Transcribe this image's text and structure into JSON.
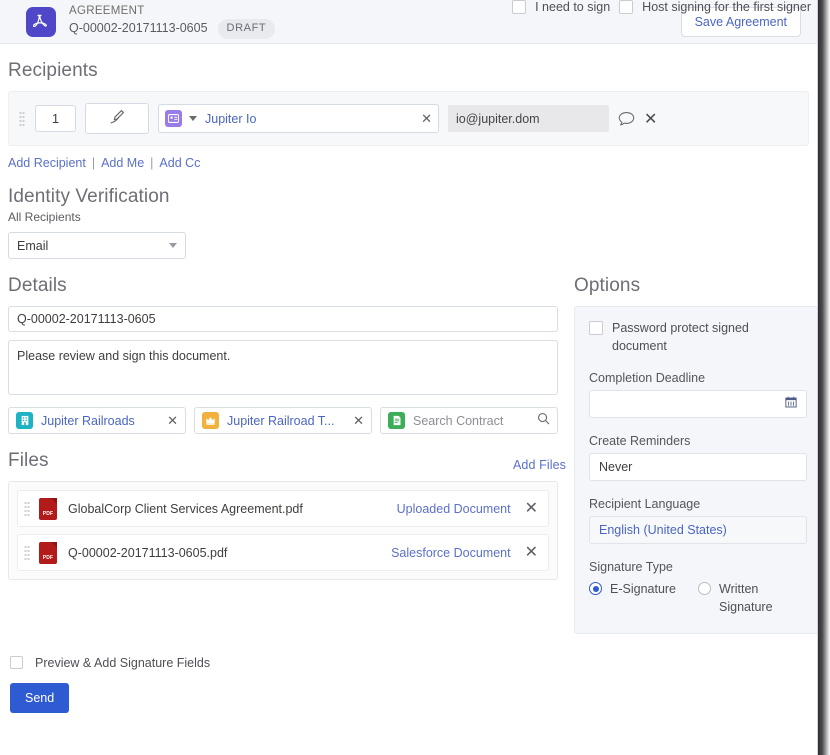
{
  "header": {
    "kicker": "AGREEMENT",
    "record_id": "Q-00002-20171113-0605",
    "status_badge": "DRAFT",
    "save_button": "Save Agreement"
  },
  "recipients": {
    "title": "Recipients",
    "row": {
      "order": "1",
      "sign_role_icon": "pen-icon",
      "object_type_icon": "contact-icon",
      "name": "Jupiter Io",
      "email": "io@jupiter.dom",
      "message_icon": "speech-bubble-icon",
      "remove_icon": "close-icon"
    },
    "links": {
      "add_recipient": "Add Recipient",
      "separator": "|",
      "add_me": "Add Me",
      "add_cc": "Add Cc"
    },
    "checkboxes": {
      "i_need_to_sign": "I need to sign",
      "host_signing": "Host signing for the first signer"
    }
  },
  "identity": {
    "title": "Identity Verification",
    "subtitle": "All Recipients",
    "method": "Email"
  },
  "details": {
    "title": "Details",
    "name_value": "Q-00002-20171113-0605",
    "message_value": "Please review and sign this document.",
    "pills": [
      {
        "icon": "account-icon",
        "color": "#1db2c4",
        "value": "Jupiter Railroads",
        "placeholder": ""
      },
      {
        "icon": "opportunity-icon",
        "color": "#f2b13c",
        "value": "Jupiter Railroad T...",
        "placeholder": ""
      },
      {
        "icon": "contract-icon",
        "color": "#3dad5a",
        "value": "",
        "placeholder": "Search Contract"
      }
    ]
  },
  "files": {
    "title": "Files",
    "add_files_link": "Add Files",
    "items": [
      {
        "name": "GlobalCorp Client Services Agreement.pdf",
        "tag": "Uploaded Document",
        "type_label": "PDF"
      },
      {
        "name": "Q-00002-20171113-0605.pdf",
        "tag": "Salesforce Document",
        "type_label": "PDF"
      }
    ]
  },
  "options": {
    "title": "Options",
    "password_protect": "Password protect signed document",
    "completion_deadline_label": "Completion Deadline",
    "completion_deadline_value": "",
    "create_reminders_label": "Create Reminders",
    "create_reminders_value": "Never",
    "recipient_language_label": "Recipient Language",
    "recipient_language_value": "English (United States)",
    "signature_type_label": "Signature Type",
    "signature_e": "E-Signature",
    "signature_written": "Written Signature"
  },
  "footer": {
    "preview_checkbox": "Preview & Add Signature Fields",
    "send_button": "Send"
  },
  "colors": {
    "brand_purple": "#4f46c8",
    "link_blue": "#5b70c9",
    "send_blue": "#2f5bd2"
  }
}
